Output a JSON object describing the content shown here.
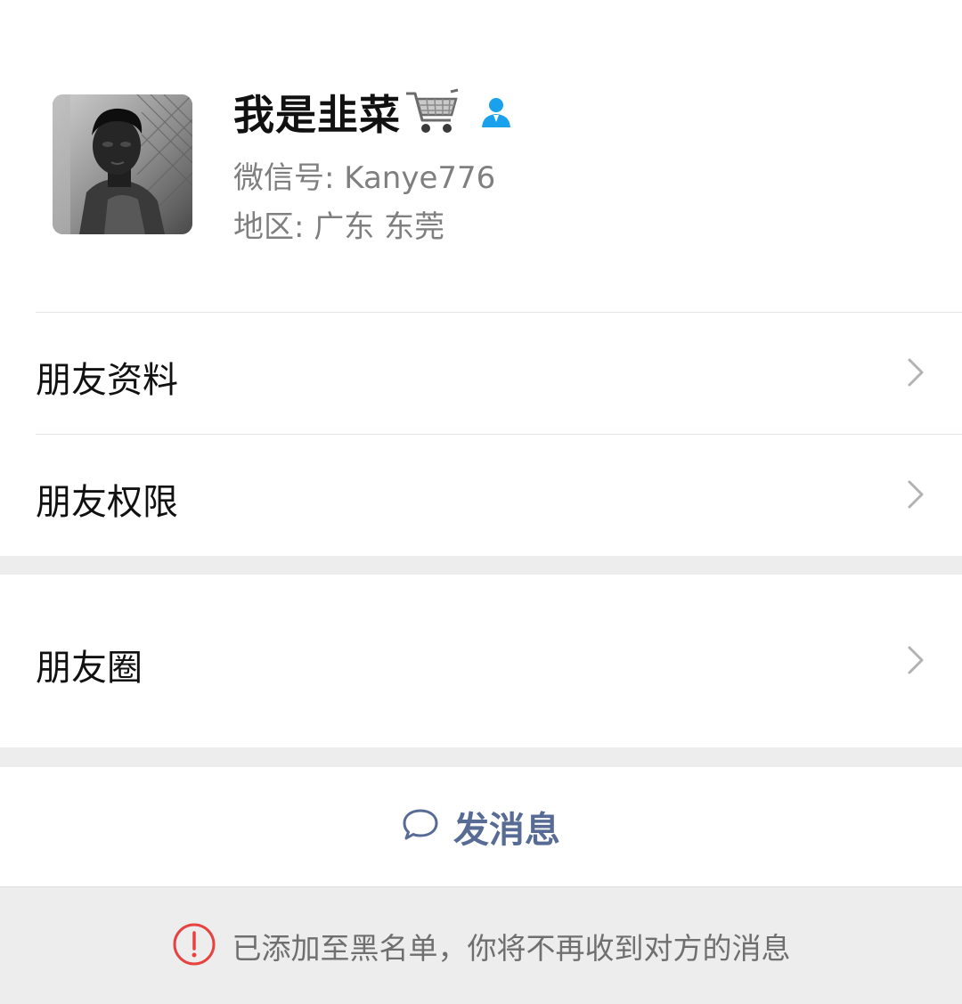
{
  "profile": {
    "nickname": "我是韭菜",
    "nickname_emoji_icon": "shopping-cart-icon",
    "gender_icon": "male-person-icon",
    "wechat_id": "微信号: Kanye776",
    "region": "地区: 广东 东莞"
  },
  "menu": {
    "friend_profile": "朋友资料",
    "friend_permissions": "朋友权限",
    "moments": "朋友圈"
  },
  "actions": {
    "send_message": "发消息"
  },
  "notice": {
    "text": "已添加至黑名单，你将不再收到对方的消息"
  },
  "colors": {
    "link_blue": "#576b95",
    "gender_blue": "#1aa1eb",
    "warning_red": "#e64340",
    "background": "#ededed"
  }
}
